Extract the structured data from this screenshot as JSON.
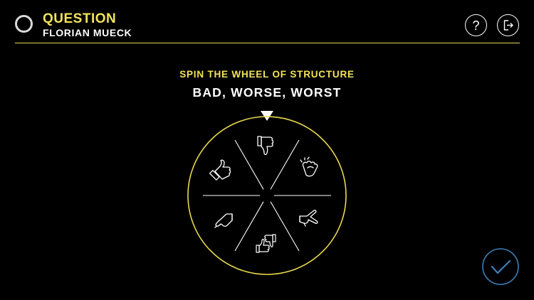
{
  "header": {
    "title": "QUESTION",
    "subtitle": "FLORIAN MUECK",
    "help_glyph": "?",
    "status_icon": "progress-ring-icon",
    "help_icon": "question-mark-icon",
    "exit_icon": "exit-door-icon"
  },
  "wheel": {
    "heading": "SPIN THE WHEEL OF STRUCTURE",
    "question": "BAD, WORSE, WORST",
    "segments": [
      {
        "icon": "thumbs-down-icon"
      },
      {
        "icon": "clapping-hands-icon"
      },
      {
        "icon": "peace-sign-hand-icon"
      },
      {
        "icon": "thumbs-up-and-down-icon"
      },
      {
        "icon": "pointing-hand-icon"
      },
      {
        "icon": "thumbs-up-icon"
      }
    ],
    "pointer_icon": "triangle-pointer-icon"
  },
  "footer": {
    "confirm_icon": "checkmark-icon"
  },
  "colors": {
    "background": "#000000",
    "accent": "#f2e35a",
    "wheel_ring": "#e8d94e",
    "text": "#ffffff",
    "confirm": "#3d7fb8"
  }
}
